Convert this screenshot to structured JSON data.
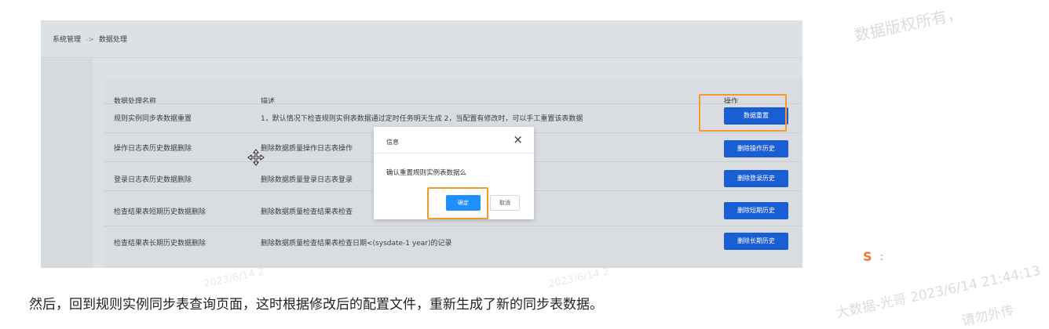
{
  "breadcrumb": {
    "root": "系统管理",
    "sep": "->",
    "current": "数据处理"
  },
  "table": {
    "headers": {
      "name": "数据处理名称",
      "desc": "描述",
      "op": "操作"
    },
    "rows": [
      {
        "name": "规则实例同步表数据重置",
        "desc": "1，默认情况下检查规则实例表数据通过定时任务明天生成 2，当配置有修改时，可以手工重置该表数据",
        "button": "数据重置"
      },
      {
        "name": "操作日志表历史数据删除",
        "desc": "删除数据质量操作日志表操作",
        "button": "删除操作历史"
      },
      {
        "name": "登录日志表历史数据删除",
        "desc": "删除数据质量登录日志表登录",
        "button": "删除登录历史"
      },
      {
        "name": "检查结果表短期历史数据删除",
        "desc": "删除数据质量检查结果表检查",
        "button": "删除短期历史"
      },
      {
        "name": "检查结果表长期历史数据删除",
        "desc": "删除数据质量检查结果表检查日期<(sysdate-1 year)的记录",
        "button": "删除长期历史"
      }
    ]
  },
  "dialog": {
    "title": "信息",
    "close": "×",
    "message": "确认重置规则实例表数据么",
    "ok": "确定",
    "cancel": "取消"
  },
  "caption": "然后，回到规则实例同步表查询页面，这时根据修改后的配置文件，重新生成了新的同步表数据。",
  "watermarks": [
    "数据版权所有，",
    "2023/6/14 2",
    "2023/6/14 2",
    "大数据-光哥 2023/6/14 21:44:13",
    "请勿外传"
  ],
  "side_icons": {
    "s_icon": "S",
    "dots": ":"
  },
  "colors": {
    "primary_button": "#1a5ed4",
    "highlight": "#f39a2b",
    "dialog_ok": "#1e8fff"
  }
}
